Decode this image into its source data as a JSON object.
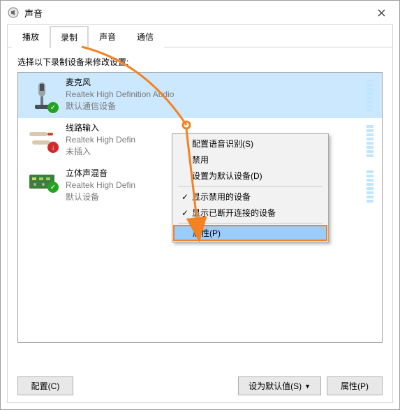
{
  "window": {
    "title": "声音",
    "close_tooltip": "关闭"
  },
  "tabs": {
    "playback": "播放",
    "recording": "录制",
    "sounds": "声音",
    "communications": "通信"
  },
  "instructions": "选择以下录制设备来修改设置:",
  "devices": [
    {
      "name": "麦克风",
      "driver": "Realtek High Definition Audio",
      "status": "默认通信设备",
      "badge": "green",
      "selected": true
    },
    {
      "name": "线路输入",
      "driver": "Realtek High Defin",
      "status": "未插入",
      "badge": "red",
      "selected": false
    },
    {
      "name": "立体声混音",
      "driver": "Realtek High Defin",
      "status": "默认设备",
      "badge": "green",
      "selected": false
    }
  ],
  "context_menu": {
    "configure_speech": "配置语音识别(S)",
    "disable": "禁用",
    "set_default": "设置为默认设备(D)",
    "show_disabled": "显示禁用的设备",
    "show_disconnected": "显示已断开连接的设备",
    "properties": "属性(P)",
    "checkmark": "✓"
  },
  "buttons": {
    "configure": "配置(C)",
    "set_default": "设为默认值(S)",
    "properties": "属性(P)",
    "dropdown_glyph": "▼"
  }
}
